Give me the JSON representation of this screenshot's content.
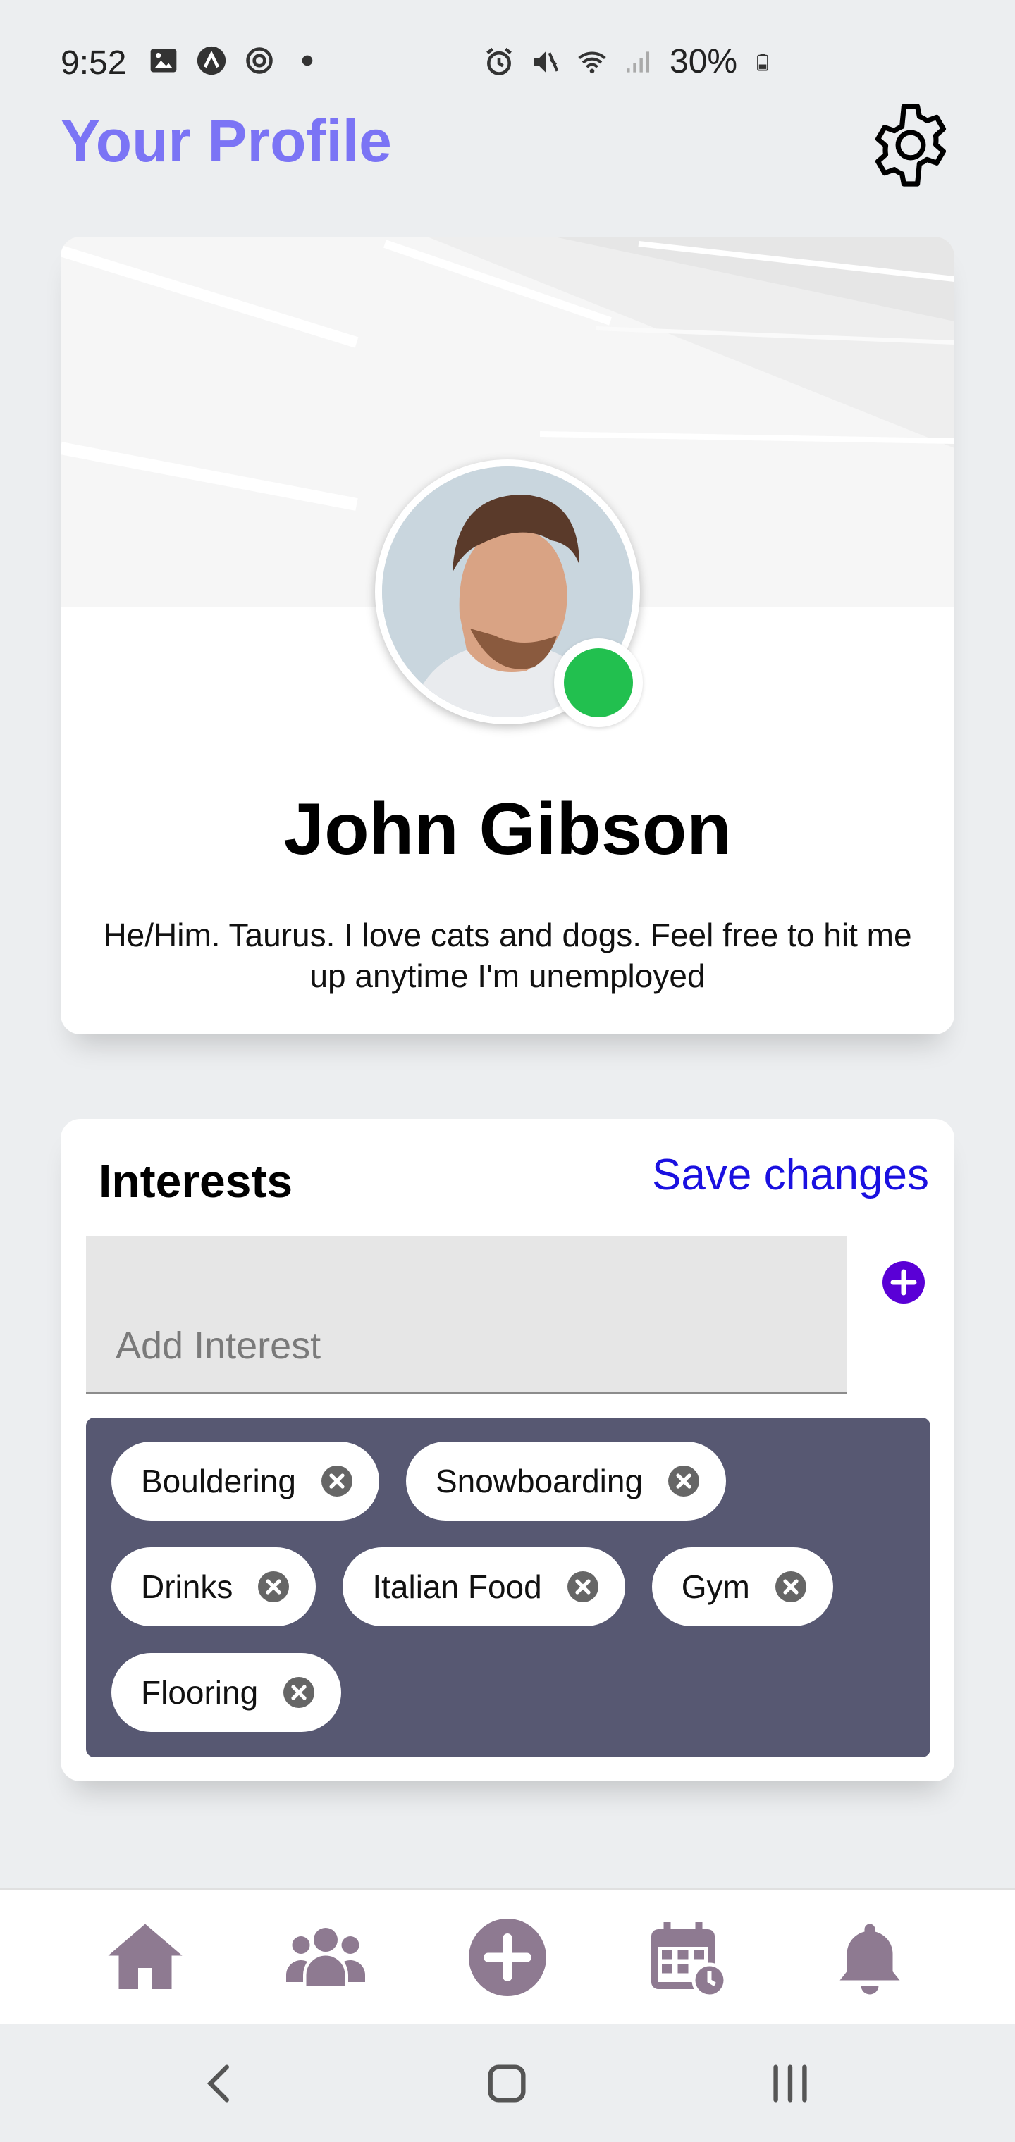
{
  "status_bar": {
    "time": "9:52",
    "battery": "30%",
    "icons": [
      "image-icon",
      "app-icon",
      "sync-icon",
      "dot-icon",
      "alarm-icon",
      "mute-icon",
      "wifi-icon",
      "signal-icon",
      "battery-icon"
    ]
  },
  "header": {
    "title": "Your Profile",
    "settings_icon": "gear-icon"
  },
  "profile": {
    "name": "John Gibson",
    "bio": "He/Him. Taurus. I love cats and dogs. Feel free to hit me up anytime I'm unemployed",
    "online": true,
    "status_color": "#22c04f"
  },
  "interests": {
    "title": "Interests",
    "save_label": "Save changes",
    "input_placeholder": "Add Interest",
    "add_icon": "plus-circle-icon",
    "tags": [
      {
        "label": "Bouldering"
      },
      {
        "label": "Snowboarding"
      },
      {
        "label": "Drinks"
      },
      {
        "label": "Italian Food"
      },
      {
        "label": "Gym"
      },
      {
        "label": "Flooring"
      }
    ]
  },
  "bottom_nav": {
    "items": [
      {
        "icon": "home-icon"
      },
      {
        "icon": "users-icon"
      },
      {
        "icon": "plus-circle-icon"
      },
      {
        "icon": "calendar-icon"
      },
      {
        "icon": "bell-icon"
      }
    ],
    "icon_color": "#8e7a91"
  },
  "system_nav": [
    "back-icon",
    "home-square-icon",
    "recents-icon"
  ],
  "colors": {
    "accent": "#7b74f5",
    "link": "#1a10e0",
    "chips_panel": "#575872",
    "add_button": "#5a00d6"
  }
}
